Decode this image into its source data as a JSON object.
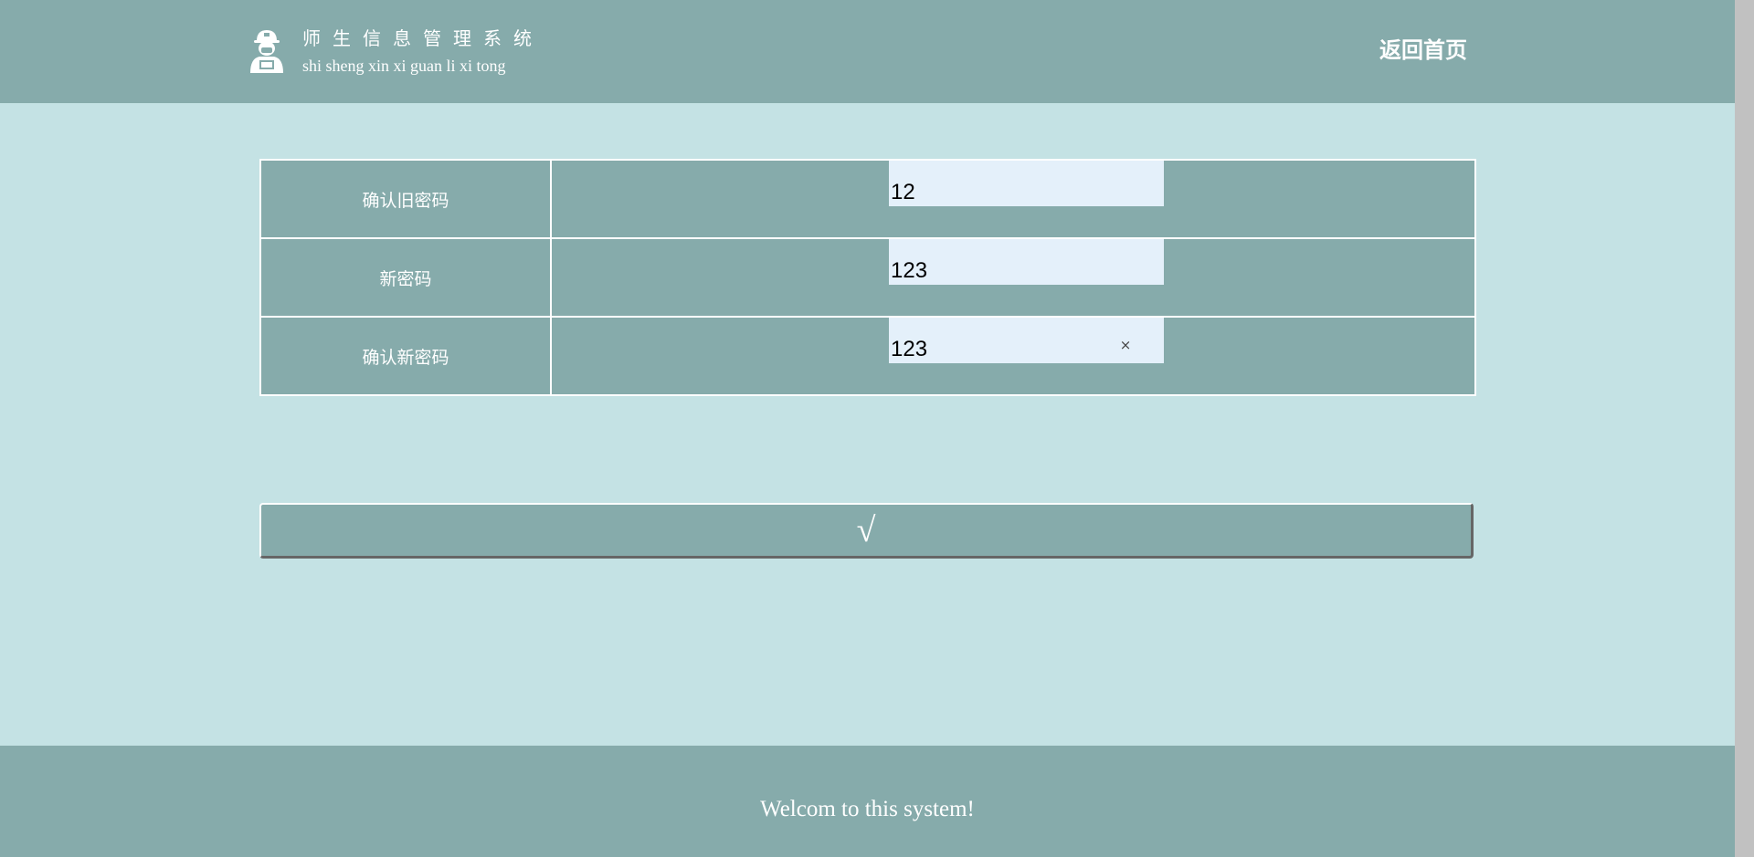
{
  "header": {
    "title_cn": "师生信息管理系统",
    "title_pinyin": "shi sheng xin xi guan li xi tong",
    "home_link": "返回首页",
    "logo_icon": "worker-avatar-icon"
  },
  "form": {
    "rows": [
      {
        "label": "确认旧密码",
        "value": "12"
      },
      {
        "label": "新密码",
        "value": "123"
      },
      {
        "label": "确认新密码",
        "value": "123"
      }
    ],
    "clear_icon": "×",
    "submit_label": "√"
  },
  "footer": {
    "text": "Welcom to this system!"
  },
  "colors": {
    "header_bg": "#86abab",
    "page_bg": "#c4e2e4",
    "input_bg": "#e4f0fa"
  }
}
